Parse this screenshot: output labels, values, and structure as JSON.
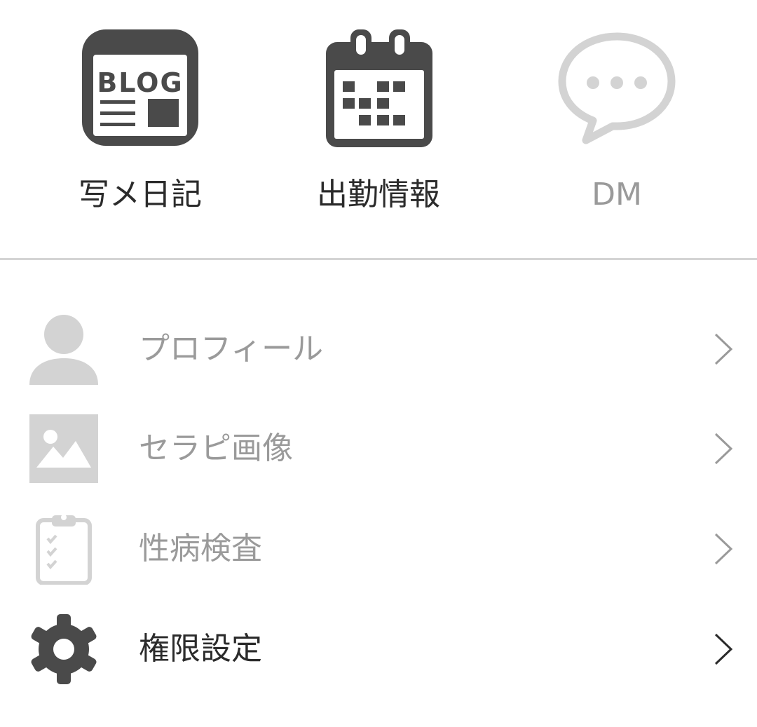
{
  "tiles": [
    {
      "label": "写メ日記",
      "icon": "blog-icon",
      "icon_text": "BLOG",
      "state": "active"
    },
    {
      "label": "出勤情報",
      "icon": "calendar-icon",
      "state": "active"
    },
    {
      "label": "DM",
      "icon": "chat-bubble-icon",
      "state": "disabled"
    }
  ],
  "menu": [
    {
      "label": "プロフィール",
      "icon": "person-icon",
      "state": "disabled"
    },
    {
      "label": "セラピ画像",
      "icon": "image-icon",
      "state": "disabled"
    },
    {
      "label": "性病検査",
      "icon": "clipboard-checklist-icon",
      "state": "disabled"
    },
    {
      "label": "権限設定",
      "icon": "gear-icon",
      "state": "active"
    }
  ],
  "colors": {
    "active": "#4a4a4a",
    "disabled": "#d3d3d3",
    "active_text": "#2b2b2b",
    "disabled_text": "#9a9a9a",
    "divider": "#d4d4d4"
  }
}
